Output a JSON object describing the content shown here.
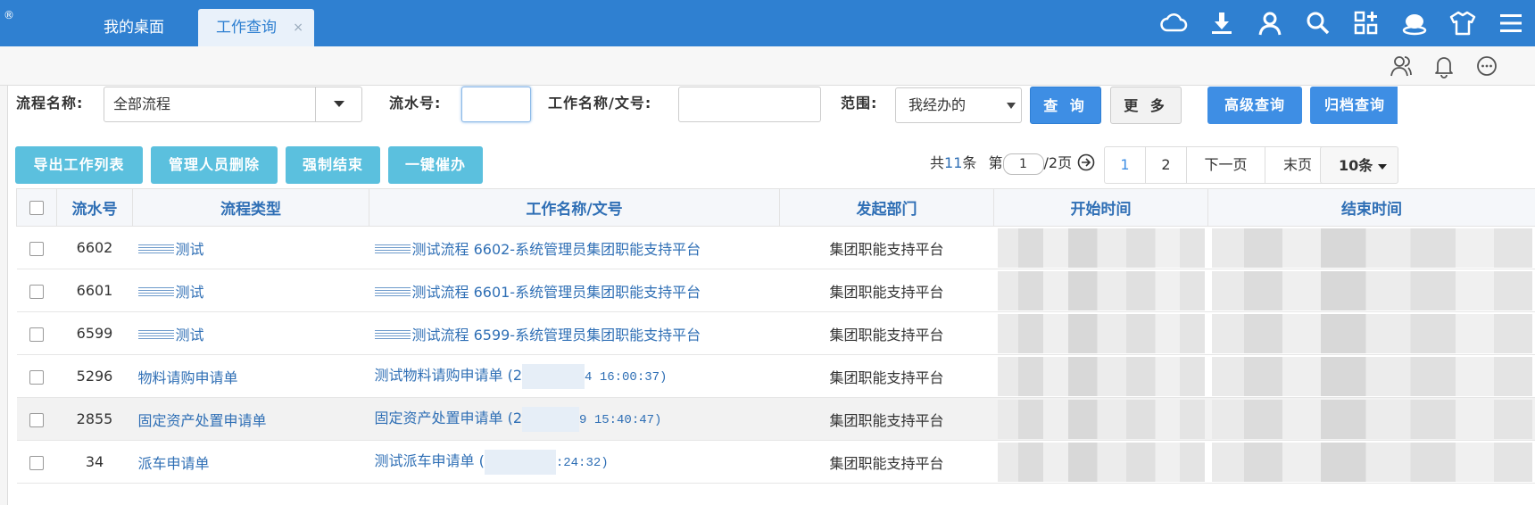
{
  "topbar": {
    "reg_mark": "®",
    "tabs": [
      {
        "label": "我的桌面"
      },
      {
        "label": "工作查询",
        "close": "×"
      }
    ]
  },
  "search": {
    "flow_name_label": "流程名称:",
    "flow_name_value": "全部流程",
    "serial_label": "流水号:",
    "serial_value": "",
    "work_name_label": "工作名称/文号:",
    "work_name_value": "",
    "scope_label": "范围:",
    "scope_value": "我经办的",
    "query_btn": "查 询",
    "more_btn": "更 多",
    "advanced_btn": "高级查询",
    "archive_btn": "归档查询"
  },
  "actions": {
    "export": "导出工作列表",
    "admin_delete": "管理人员删除",
    "force_end": "强制结束",
    "urge": "一键催办"
  },
  "pager": {
    "total_prefix": "共",
    "total": "11",
    "total_suffix": "条",
    "page_prefix": "第",
    "page_value": "1",
    "page_suffix": "/2页",
    "page1": "1",
    "page2": "2",
    "next": "下一页",
    "last": "末页",
    "size": "10条"
  },
  "table": {
    "headers": {
      "serial": "流水号",
      "type": "流程类型",
      "name": "工作名称/文号",
      "dept": "发起部门",
      "start": "开始时间",
      "end": "结束时间"
    },
    "rows": [
      {
        "serial": "6602",
        "type": "测试",
        "name": "测试流程 6602-系统管理员集团职能支持平台",
        "dept": "集团职能支持平台"
      },
      {
        "serial": "6601",
        "type": "测试",
        "name": "测试流程 6601-系统管理员集团职能支持平台",
        "dept": "集团职能支持平台"
      },
      {
        "serial": "6599",
        "type": "测试",
        "name": "测试流程 6599-系统管理员集团职能支持平台",
        "dept": "集团职能支持平台"
      },
      {
        "serial": "5296",
        "type": "物料请购申请单",
        "name_a": "测试物料请购申请单 (2",
        "name_b": "4 16:00:37)",
        "dept": "集团职能支持平台"
      },
      {
        "serial": "2855",
        "type": "固定资产处置申请单",
        "name_a": "固定资产处置申请单 (2",
        "name_b": "9 15:40:47)",
        "dept": "集团职能支持平台"
      },
      {
        "serial": "34",
        "type": "派车申请单",
        "name_a": "测试派车申请单 (",
        "name_b": ":24:32)",
        "dept": "集团职能支持平台"
      }
    ]
  },
  "colors": {
    "topbar": "#2f80d1",
    "primary_button": "#3e8ee4",
    "action_button": "#5bc0de",
    "link": "#2f6fb5"
  }
}
